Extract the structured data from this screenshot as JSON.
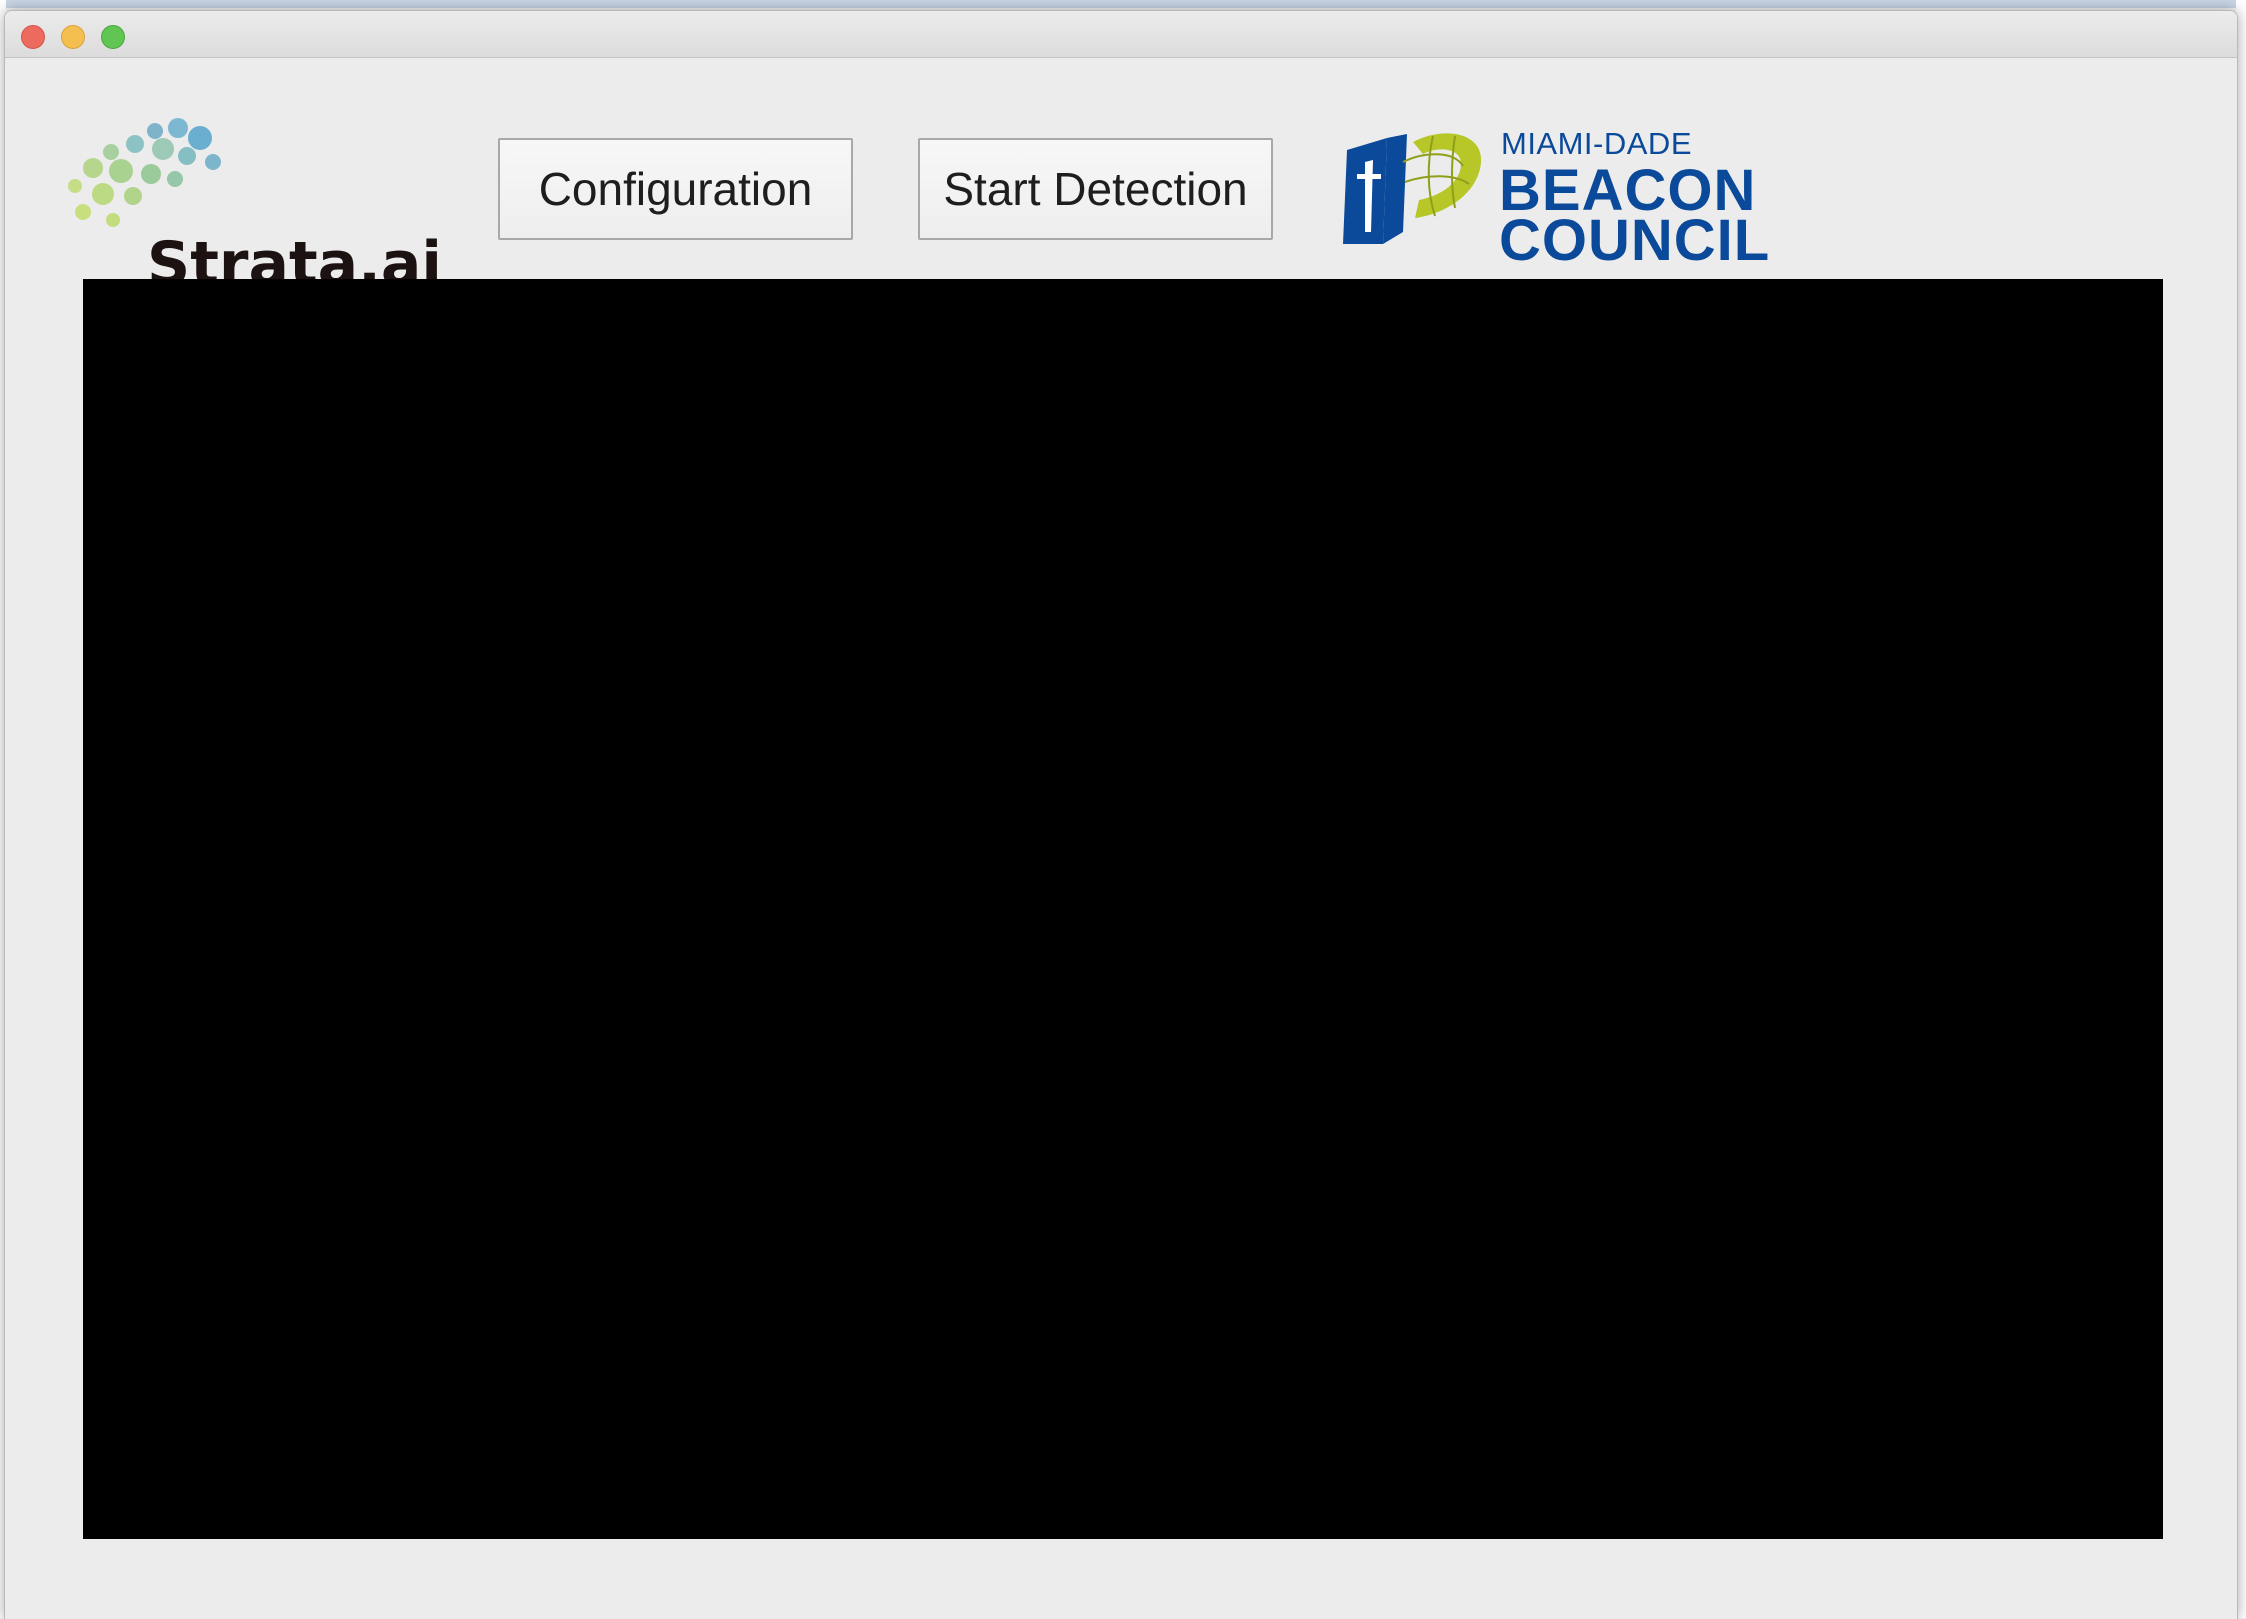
{
  "window": {
    "controls": [
      "close",
      "minimize",
      "maximize"
    ]
  },
  "toolbar": {
    "logo_text": "Strata.ai",
    "configuration_label": "Configuration",
    "start_detection_label": "Start Detection"
  },
  "partner_logo": {
    "line1": "MIAMI-DADE",
    "line2": "BEACON",
    "line3": "COUNCIL"
  },
  "colors": {
    "beacon_blue": "#0b4a9a",
    "beacon_green": "#b7c727",
    "video_background": "#000000"
  }
}
